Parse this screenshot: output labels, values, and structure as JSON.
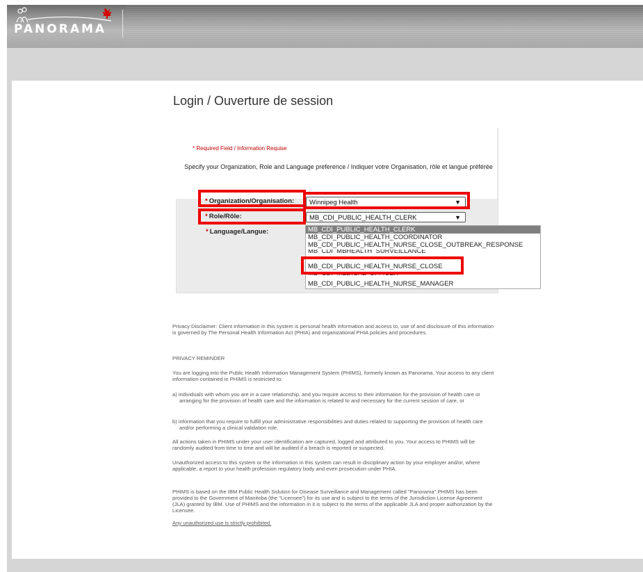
{
  "header": {
    "logo_text": "PANORAMA"
  },
  "login": {
    "title": "Login / Ouverture de session",
    "required_note": "*  Required Field / Information Requise",
    "instructions": "Specify your Organization, Role and Language preference / Indiquer votre Organisation, rôle et langue préférée",
    "org_label": "Organization/Organisation:",
    "org_value": "Winnipeg Health",
    "role_label": "Role/Rôle:",
    "role_value": "MB_CDI_PUBLIC_HEALTH_CLERK",
    "language_label": "Language/Langue:",
    "required_star": "*"
  },
  "role_options": [
    "MB_CDI_PUBLIC_HEALTH_CLERK",
    "MB_CDI_PUBLIC_HEALTH_COORDINATOR",
    "MB_CDI_PUBLIC_HEALTH_NURSE_CLOSE_OUTBREAK_RESPONSE",
    "MB_CDI_MBHEALTH_SURVEILLANCE",
    "MB_CDI_PUBLIC_HEALTH_NURSE_CLOSE",
    "MB_CDI_MEDICAL_OFFICER",
    "MB_CDI_PUBLIC_HEALTH_NURSE_MANAGER"
  ],
  "privacy": {
    "disclaimer": "Privacy Disclaimer: Client information in this system is personal health information and access to, use of and disclosure of this information is governed by The Personal Health Information Act (PHIA) and organizational PHIA policies and procedures.",
    "reminder_heading": "PRIVACY REMINDER",
    "para1": "You are logging into the Public Health Information Management System (PHIMS), formerly known as Panorama. Your access to any client information contained in PHIMS is restricted to:",
    "item_a": "a) individuals with whom you are in a care relationship, and you require access to their information for the provision of health care or arranging for the provision of health care and the information is related to and necessary for the current session of care, or",
    "item_b": "b) information that you require to fulfill your administrative responsibilities and duties related to supporting the provision of health care and/or performing a clinical validation role.",
    "para2": "All actions taken in PHIMS under your user identification are captured, logged and attributed to you. Your access to PHIMS will be randomly audited from time to time and will be audited if a breach is reported or suspected.",
    "para3": "Unauthorized access to this system or the information in this system can result in disciplinary action by your employer and/or, where applicable, a report to your health profession regulatory body and even prosecution under PHIA.",
    "para4": "PHIMS is based on the IBM Public Health Solution for Disease Surveillance and Management called \"Panorama\".PHIMS has been provided to the Government of Manitoba (the \"Licensee\") for its use and is subject to the terms of the Jurisdiction License Agreement (JLA) granted by IBM. Use of PHIMS and the information in it is subject to the terms of the applicable JLA and proper authorization by the Licensee.",
    "link": "Any unauthorized use is strictly prohibited."
  },
  "colors": {
    "highlight": "#ee0000",
    "selected_option": "#7f7f7f"
  }
}
